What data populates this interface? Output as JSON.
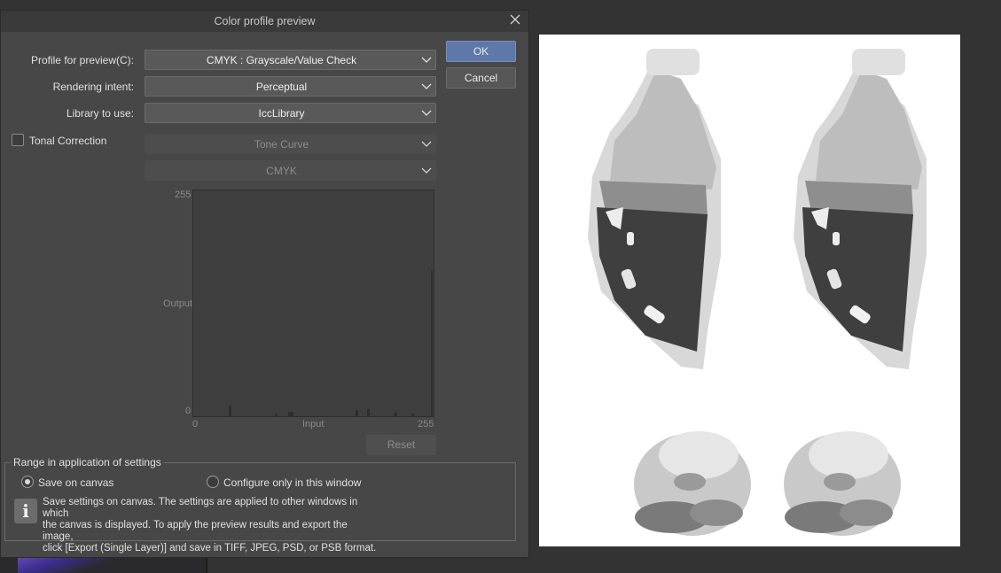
{
  "dialog": {
    "title": "Color profile preview",
    "ok_label": "OK",
    "cancel_label": "Cancel",
    "profile_label": "Profile for preview(C):",
    "profile_value": "CMYK : Grayscale/Value Check",
    "intent_label": "Rendering intent:",
    "intent_value": "Perceptual",
    "library_label": "Library to use:",
    "library_value": "IccLibrary",
    "tonal_label": "Tonal Correction",
    "tonal_checked": false,
    "curve_value": "Tone Curve",
    "channel_value": "CMYK",
    "graph": {
      "y_max": "255",
      "y_min": "0",
      "y_label": "Output",
      "x_min": "0",
      "x_label": "Input",
      "x_max": "255"
    },
    "reset_label": "Reset",
    "range": {
      "title": "Range in application of settings",
      "option_canvas": "Save on canvas",
      "option_window": "Configure only in this window",
      "selected": "Save on canvas",
      "info_line1": "Save settings on canvas. The settings are applied to other windows in which",
      "info_line2": "the canvas is displayed. To apply the preview results and export the image,",
      "info_line3": "click [Export (Single Layer)] and save in TIFF, JPEG, PSD, or PSB format."
    }
  },
  "icons": {
    "close": "close-icon",
    "dropdown": "chevron-down-icon",
    "info": "info-icon"
  },
  "colors": {
    "primary_button": "#5f78a8",
    "dialog_bg": "#474747",
    "canvas_bg": "#ffffff"
  }
}
